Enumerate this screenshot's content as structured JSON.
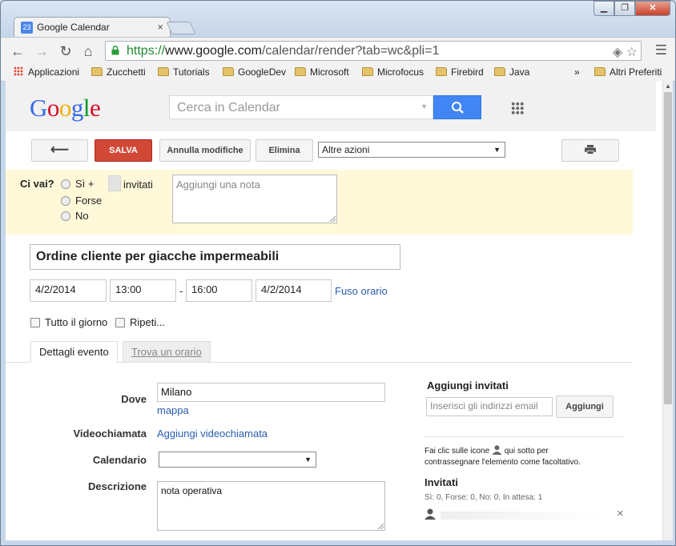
{
  "browser": {
    "tab_title": "Google Calendar",
    "tab_favicon_text": "23",
    "url_scheme": "https://",
    "url_host": "www.google.com",
    "url_path": "/calendar/render?tab=wc&pli=1",
    "bookmarks": [
      "Applicazioni",
      "Zucchetti",
      "Tutorials",
      "GoogleDev",
      "Microsoft",
      "Microfocus",
      "Firebird",
      "Java"
    ],
    "bookmarks_overflow": "»",
    "other_bookmarks": "Altri Preferiti"
  },
  "header": {
    "search_placeholder": "Cerca in Calendar"
  },
  "actions": {
    "save": "SALVA",
    "discard": "Annulla modifiche",
    "delete": "Elimina",
    "more": "Altre azioni"
  },
  "rsvp": {
    "question": "Ci vai?",
    "yes": "Sì +",
    "invited": "invitati",
    "maybe": "Forse",
    "no": "No",
    "note_placeholder": "Aggiungi una nota"
  },
  "event": {
    "title": "Ordine cliente per giacche impermeabili",
    "start_date": "4/2/2014",
    "start_time": "13:00",
    "dash": "-",
    "end_time": "16:00",
    "end_date": "4/2/2014",
    "timezone": "Fuso orario",
    "all_day": "Tutto il giorno",
    "repeat": "Ripeti..."
  },
  "tabs": {
    "details": "Dettagli evento",
    "find_time": "Trova un orario"
  },
  "details": {
    "where_label": "Dove",
    "where_value": "Milano",
    "map_link": "mappa",
    "video_label": "Videochiamata",
    "video_link": "Aggiungi videochiamata",
    "calendar_label": "Calendario",
    "calendar_value": "",
    "description_label": "Descrizione",
    "description_value": "nota operativa"
  },
  "guests": {
    "title": "Aggiungi invitati",
    "input_placeholder": "Inserisci gli indirizzi email",
    "add_button": "Aggiungi",
    "hint_part1": "Fai clic sulle icone",
    "hint_part2": "qui sotto per",
    "hint_line2": "contrassegnare l'elemento come facoltativo.",
    "invited_title": "Invitati",
    "counts": "Sì: 0, Forse: 0, No: 0, In attesa: 1",
    "remove": "×"
  }
}
